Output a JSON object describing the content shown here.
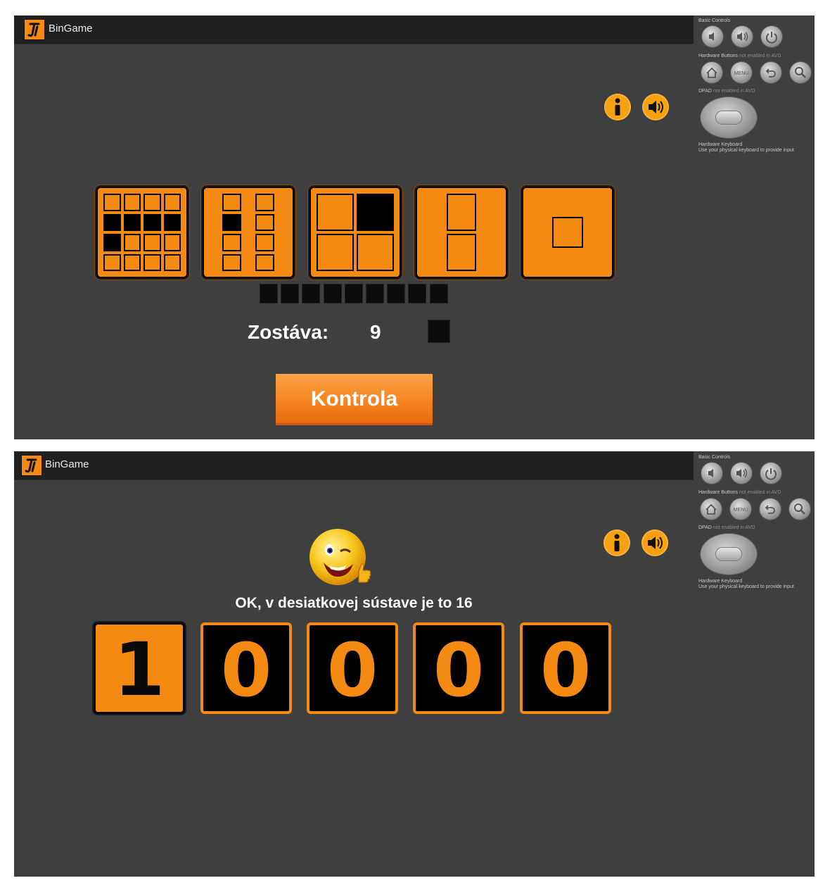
{
  "screen1": {
    "app_title": "BinGame",
    "emulator": {
      "basic_controls": "Basic Controls",
      "hardware_buttons": "Hardware Buttons",
      "hardware_buttons_note": "not enabled in AVD",
      "dpad": "DPAD",
      "dpad_note": "not enabled in AVD",
      "keyboard_title": "Hardware Keyboard",
      "keyboard_note": "Use your physical keyboard to provide input",
      "menu_label": "MENU"
    },
    "icons": [
      "info-icon",
      "sound-icon"
    ],
    "tiles": [
      {
        "value": 16,
        "cols": 4,
        "rows": 4,
        "on": [
          4,
          5,
          6,
          7,
          8
        ]
      },
      {
        "value": 8,
        "cols": 2,
        "rows": 4,
        "on": [
          2
        ]
      },
      {
        "value": 4,
        "cols": 2,
        "rows": 2,
        "on": [
          1
        ]
      },
      {
        "value": 2,
        "cols": 1,
        "rows": 2,
        "on": []
      },
      {
        "value": 1,
        "cols": 1,
        "rows": 1,
        "on": []
      }
    ],
    "remaining_squares": 9,
    "remaining_label": "Zostáva:",
    "remaining_value": "9",
    "check_button": "Kontrola"
  },
  "screen2": {
    "app_title": "BinGame",
    "emulator": {
      "basic_controls": "Basic Controls",
      "hardware_buttons": "Hardware Buttons",
      "hardware_buttons_note": "not enabled in AVD",
      "dpad": "DPAD",
      "dpad_note": "not enabled in AVD",
      "keyboard_title": "Hardware Keyboard",
      "keyboard_note": "Use your physical keyboard to provide input",
      "menu_label": "MENU"
    },
    "result_message": "OK, v desiatkovej sústave je to 16",
    "digits": [
      "1",
      "0",
      "0",
      "0",
      "0"
    ],
    "accent_color": "#f58a12"
  }
}
